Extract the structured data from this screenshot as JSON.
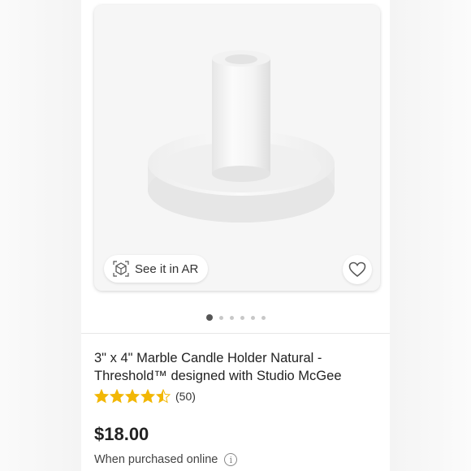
{
  "product_gallery": {
    "ar_label": "See it in AR",
    "ar_icon": "ar-cube-icon",
    "favorite_icon": "heart-icon",
    "image_count": 6,
    "active_image_index": 0
  },
  "product": {
    "title": "3\" x 4\" Marble Candle Holder Natural - Threshold™ designed with Studio McGee",
    "rating": 4.5,
    "rating_max": 5,
    "review_count": "(50)",
    "price": "$18.00",
    "purchase_note": "When purchased online",
    "info_icon": "info-icon"
  },
  "colors": {
    "star": "#F2B705",
    "price": "#222222"
  }
}
